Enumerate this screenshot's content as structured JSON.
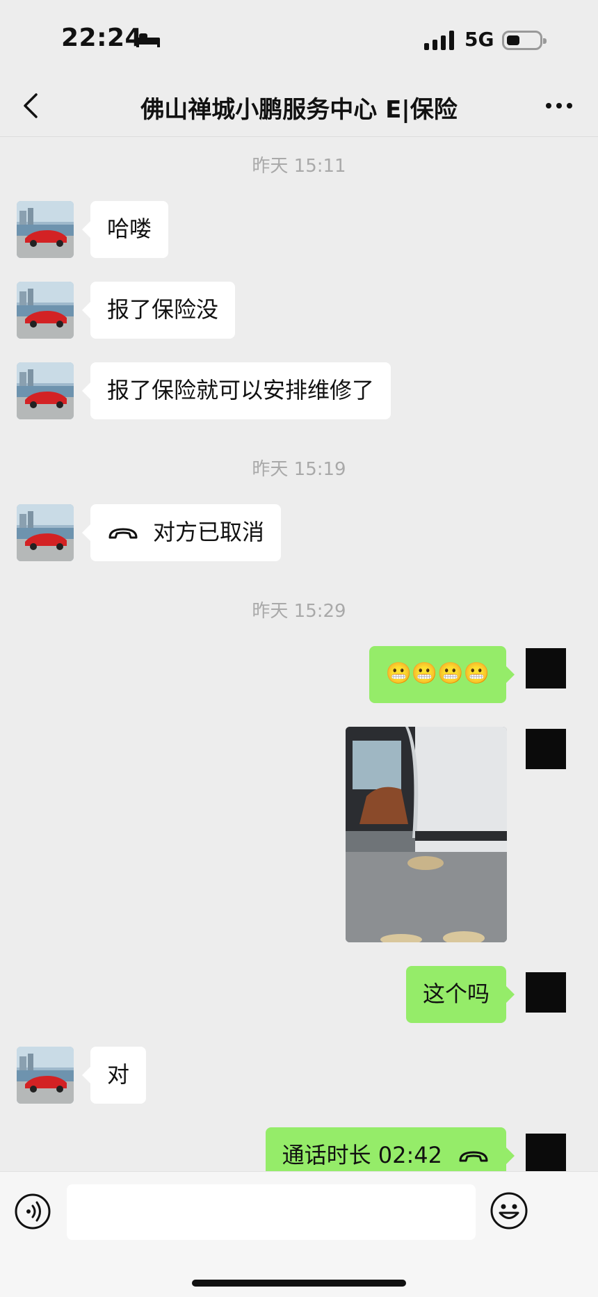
{
  "status_bar": {
    "time": "22:24",
    "network": "5G"
  },
  "header": {
    "title": "佛山禅城小鹏服务中心 E|保险"
  },
  "messages": {
    "ts1": "昨天 15:11",
    "m1": "哈喽",
    "m2": "报了保险没",
    "m3": "报了保险就可以安排维修了",
    "ts2": "昨天 15:19",
    "m4": "对方已取消",
    "ts3": "昨天 15:29",
    "m5": "😬😬😬😬",
    "m6": "这个吗",
    "m7": "对",
    "m8": "通话时长 02:42"
  },
  "colors": {
    "sent_bubble": "#95ec69",
    "received_bubble": "#ffffff",
    "background": "#ededed"
  },
  "icons": [
    "back-icon",
    "more-icon",
    "phone-hangup-icon",
    "voice-icon",
    "emoji-icon",
    "bed-icon",
    "signal-icon",
    "battery-icon"
  ]
}
